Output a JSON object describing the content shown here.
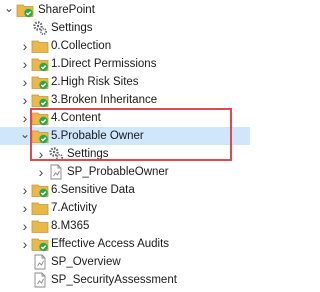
{
  "tree": [
    {
      "label": "SharePoint",
      "icon": "folder-check-icon",
      "toggle": "expanded",
      "level": 0
    },
    {
      "label": "Settings",
      "icon": "gear-icon",
      "toggle": "none",
      "level": 1
    },
    {
      "label": "0.Collection",
      "icon": "folder-icon",
      "toggle": "collapsed",
      "level": 1
    },
    {
      "label": "1.Direct Permissions",
      "icon": "folder-check-icon",
      "toggle": "collapsed",
      "level": 1
    },
    {
      "label": "2.High Risk Sites",
      "icon": "folder-check-icon",
      "toggle": "collapsed",
      "level": 1
    },
    {
      "label": "3.Broken Inheritance",
      "icon": "folder-check-icon",
      "toggle": "collapsed",
      "level": 1
    },
    {
      "label": "4.Content",
      "icon": "folder-check-icon",
      "toggle": "collapsed",
      "level": 1
    },
    {
      "label": "5.Probable Owner",
      "icon": "folder-check-icon",
      "toggle": "expanded",
      "level": 1,
      "selected": true
    },
    {
      "label": "Settings",
      "icon": "gear-icon",
      "toggle": "collapsed",
      "level": 2
    },
    {
      "label": "SP_ProbableOwner",
      "icon": "report-icon",
      "toggle": "collapsed",
      "level": 2
    },
    {
      "label": "6.Sensitive Data",
      "icon": "folder-check-icon",
      "toggle": "collapsed",
      "level": 1
    },
    {
      "label": "7.Activity",
      "icon": "folder-icon",
      "toggle": "collapsed",
      "level": 1
    },
    {
      "label": "8.M365",
      "icon": "folder-icon",
      "toggle": "collapsed",
      "level": 1
    },
    {
      "label": "Effective Access Audits",
      "icon": "folder-check-icon",
      "toggle": "collapsed",
      "level": 1
    },
    {
      "label": "SP_Overview",
      "icon": "report-icon",
      "toggle": "none",
      "level": 1
    },
    {
      "label": "SP_SecurityAssessment",
      "icon": "report-icon",
      "toggle": "none",
      "level": 1
    }
  ],
  "colors": {
    "folder": "#e8b84a",
    "check": "#2aa84a",
    "selection": "#cfe6fb",
    "highlight": "#e4474f"
  }
}
